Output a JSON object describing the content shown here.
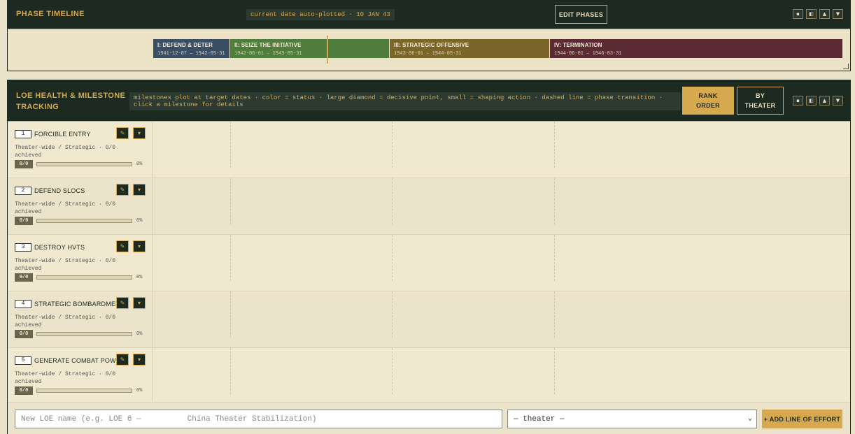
{
  "phase_timeline": {
    "title": "PHASE TIMELINE",
    "current_date_chip": "current date auto-plotted · 10 JAN 43",
    "edit_button": "EDIT PHASES",
    "controls": [
      "▪",
      "◧",
      "▲",
      "▼"
    ],
    "phases": [
      {
        "name": "I: DEFEND & DETER",
        "dates": "1941-12-07 – 1942-05-31",
        "color": "#3b4f64"
      },
      {
        "name": "II: SEIZE THE INITIATIVE",
        "dates": "1942-06-01 – 1943-05-31",
        "color": "#4e7d3c"
      },
      {
        "name": "III: STRATEGIC OFFENSIVE",
        "dates": "1943-06-01 – 1944-05-31",
        "color": "#7a6628"
      },
      {
        "name": "IV: TERMINATION",
        "dates": "1944-06-01 – 1946-03-31",
        "color": "#5c2a32"
      }
    ]
  },
  "loe_panel": {
    "title_line1": "LOE HEALTH & MILESTONE",
    "title_line2": "TRACKING",
    "legend_chip": "milestones plot at target dates · color = status · large diamond = decisive point, small = shaping action · dashed line = phase transition · click a milestone for details",
    "rank_order_line1": "RANK",
    "rank_order_line2": "ORDER",
    "by_theater_line1": "BY",
    "by_theater_line2": "THEATER",
    "controls": [
      "▪",
      "◧",
      "▲",
      "▼"
    ],
    "rows": [
      {
        "num": "1",
        "name": "FORCIBLE ENTRY",
        "sub": "Theater-wide / Strategic · 0/0 achieved",
        "count": "0/0",
        "pct": "0%",
        "progress": 0
      },
      {
        "num": "2",
        "name": "DEFEND SLOCS",
        "sub": "Theater-wide / Strategic · 0/0 achieved",
        "count": "0/0",
        "pct": "0%",
        "progress": 0
      },
      {
        "num": "3",
        "name": "DESTROY HVTS",
        "sub": "Theater-wide / Strategic · 0/0 achieved",
        "count": "0/0",
        "pct": "0%",
        "progress": 0
      },
      {
        "num": "4",
        "name": "STRATEGIC BOMBARDMENT",
        "sub": "Theater-wide / Strategic · 0/0 achieved",
        "count": "0/0",
        "pct": "0%",
        "progress": 0
      },
      {
        "num": "5",
        "name": "GENERATE COMBAT POWER",
        "sub": "Theater-wide / Strategic · 0/0 achieved",
        "count": "0/0",
        "pct": "0%",
        "progress": 0
      }
    ],
    "row_icons": [
      "✎",
      "▾"
    ],
    "add_form": {
      "name_placeholder": "New LOE name (e.g. LOE 6 —          China Theater Stabilization)",
      "theater_select": "— theater —",
      "add_button": "+ ADD LINE OF EFFORT"
    }
  }
}
